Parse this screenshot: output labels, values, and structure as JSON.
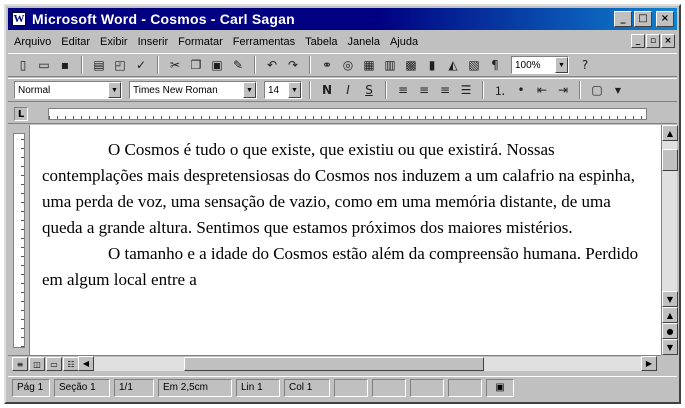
{
  "window": {
    "title": "Microsoft Word - Cosmos - Carl Sagan",
    "app_icon_label": "W"
  },
  "menu": {
    "items": [
      "Arquivo",
      "Editar",
      "Exibir",
      "Inserir",
      "Formatar",
      "Ferramentas",
      "Tabela",
      "Janela",
      "Ajuda"
    ]
  },
  "toolbar_standard": {
    "zoom_value": "100%"
  },
  "toolbar_formatting": {
    "style_value": "Normal",
    "font_value": "Times New Roman",
    "size_value": "14"
  },
  "document": {
    "paragraphs": [
      "O Cosmos é tudo o que existe, que existiu ou que existirá. Nossas contemplações mais despretensiosas do Cosmos nos induzem a um calafrio na espinha, uma perda de voz, uma sensação de vazio, como em uma memória distante, de uma queda a grande altura. Sentimos que estamos próximos dos maiores mistérios.",
      "O tamanho e a idade do Cosmos estão além da compreensão humana. Perdido em algum local entre a"
    ]
  },
  "statusbar": {
    "page": "Pág 1",
    "section": "Seção 1",
    "pages": "1/1",
    "position": "Em 2,5cm",
    "line": "Lin 1",
    "column": "Col 1"
  }
}
